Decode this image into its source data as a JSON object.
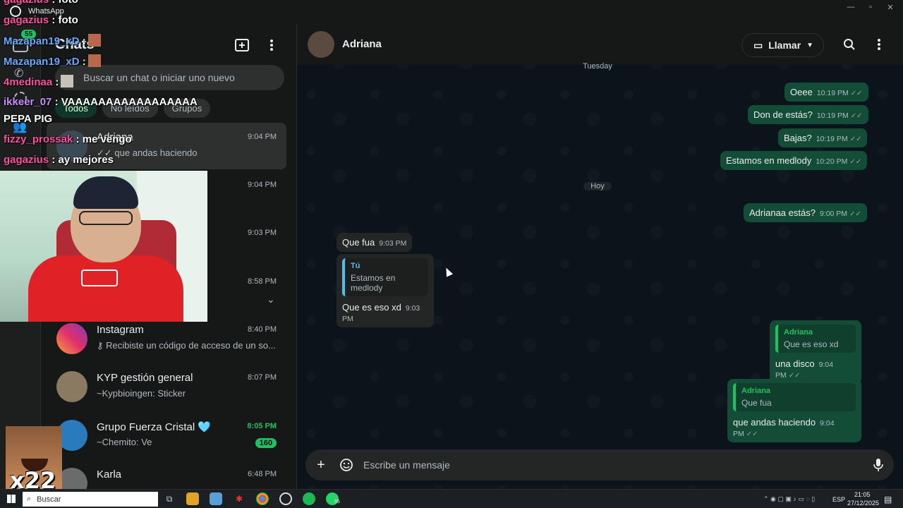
{
  "window": {
    "title": "WhatsApp",
    "rail_badge": "55"
  },
  "left_panel": {
    "title": "Chats",
    "search_placeholder": "Buscar un chat o iniciar uno nuevo",
    "filters": [
      "Todos",
      "No leídos",
      "Grupos"
    ],
    "chats": [
      {
        "name": "Adriana",
        "time": "9:04 PM",
        "preview": "que andas haciendo",
        "selected": true
      },
      {
        "name": "",
        "time": "9:04 PM",
        "preview": ""
      },
      {
        "name": "",
        "time": "9:03 PM",
        "preview": ""
      },
      {
        "name": "",
        "time": "8:58 PM",
        "preview": ""
      },
      {
        "name": "Instagram",
        "time": "8:40 PM",
        "preview": "Recibiste un código de acceso de un so..."
      },
      {
        "name": "KYP gestión general",
        "time": "8:07 PM",
        "preview": "~Kypbioingen: Sticker"
      },
      {
        "name": "Grupo Fuerza Cristal 🩵",
        "time": "8:05 PM",
        "preview": "~Chemito: Ve",
        "unread": "160"
      },
      {
        "name": "Karla",
        "time": "6:48 PM",
        "preview": ""
      }
    ]
  },
  "conversation": {
    "contact_name": "Adriana",
    "call_label": "Llamar",
    "composer_placeholder": "Escribe un mensaje",
    "day_labels": [
      "Tuesday",
      "Hoy"
    ],
    "messages": [
      {
        "dir": "out",
        "text": "Oeee",
        "time": "10:19 PM"
      },
      {
        "dir": "out",
        "text": "Don de estás?",
        "time": "10:19 PM"
      },
      {
        "dir": "out",
        "text": "Bajas?",
        "time": "10:19 PM"
      },
      {
        "dir": "out",
        "text": "Estamos en medlody",
        "time": "10:20 PM"
      },
      {
        "dir": "out",
        "text": "Adrianaa estás?",
        "time": "9:00 PM"
      },
      {
        "dir": "in",
        "text": "Que fua",
        "time": "9:03 PM"
      },
      {
        "dir": "in",
        "text": "Que es eso xd",
        "time": "9:03 PM",
        "quote_name": "Tú",
        "quote_text": "Estamos en medlody"
      },
      {
        "dir": "out",
        "text": "una disco",
        "time": "9:04 PM",
        "quote_name": "Adriana",
        "quote_text": "Que es eso xd"
      },
      {
        "dir": "out",
        "text": "que andas haciendo",
        "time": "9:04 PM",
        "quote_name": "Adriana",
        "quote_text": "Que fua"
      }
    ]
  },
  "stream_overlay": {
    "chat_lines": [
      {
        "user": "gagazius",
        "msg": ": foto"
      },
      {
        "user": "gagazius",
        "msg": ": foto"
      },
      {
        "user": "Mazapan19_xD",
        "msg": ":"
      },
      {
        "user": "Mazapan19_xD",
        "msg": ":"
      },
      {
        "user": "4medinaa",
        "msg": ":"
      },
      {
        "user": "ikkeer_07",
        "msg": ": VAAAAAAAAAAAAAAAAA"
      },
      {
        "user": "",
        "msg": "PEPA PIG"
      },
      {
        "user": "fizzy_prossak",
        "msg": ": me vengo"
      },
      {
        "user": "gagazius",
        "msg": ": ay mejores"
      }
    ],
    "meme_text": "x22"
  },
  "taskbar": {
    "search_label": "Buscar",
    "lang": "ESP",
    "time": "21:05",
    "date": "27/12/2025",
    "whatsapp_badge": "55"
  }
}
